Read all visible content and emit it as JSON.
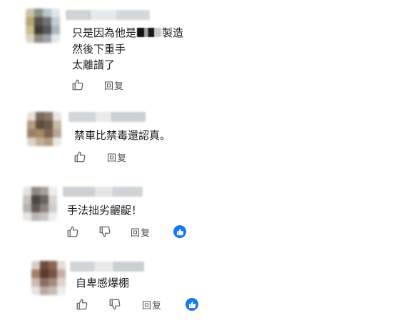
{
  "comments": [
    {
      "lines": [
        "只是因為他是",
        "製造",
        "然後下重手",
        "太離譜了"
      ],
      "reply_label": "回复",
      "has_dislike": false,
      "has_reaction": false
    },
    {
      "lines": [
        "禁車比禁毒還認真。"
      ],
      "reply_label": "回复",
      "has_dislike": false,
      "has_reaction": false
    },
    {
      "lines": [
        "手法拙劣齷齪！"
      ],
      "reply_label": "回复",
      "has_dislike": true,
      "has_reaction": true
    },
    {
      "lines": [
        "自卑感爆棚"
      ],
      "reply_label": "回复",
      "has_dislike": true,
      "has_reaction": true
    }
  ],
  "icons": {
    "like": "thumbs-up-icon",
    "dislike": "thumbs-down-icon",
    "reaction": "like-reaction-icon"
  },
  "colors": {
    "reaction_blue": "#1877f2",
    "icon_gray": "#65676b"
  }
}
